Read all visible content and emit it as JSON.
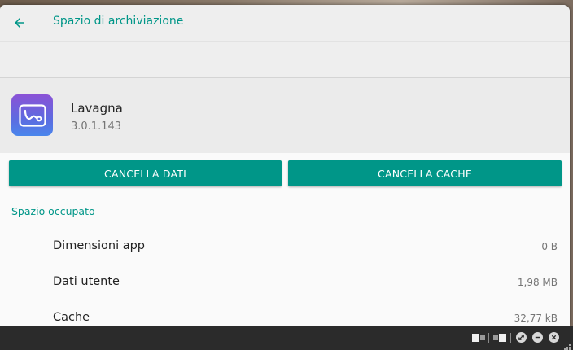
{
  "appbar": {
    "title": "Spazio di archiviazione",
    "back_icon": "arrow-left-icon"
  },
  "app": {
    "name": "Lavagna",
    "version": "3.0.1.143",
    "icon": "whiteboard-app-icon"
  },
  "actions": {
    "clear_data": "CANCELLA DATI",
    "clear_cache": "CANCELLA CACHE"
  },
  "storage": {
    "section_title": "Spazio occupato",
    "rows": [
      {
        "label": "Dimensioni app",
        "value": "0 B"
      },
      {
        "label": "Dati utente",
        "value": "1,98 MB"
      },
      {
        "label": "Cache",
        "value": "32,77 kB"
      }
    ]
  },
  "taskbar": {
    "icons": [
      "window-layout-left-icon",
      "window-layout-right-icon",
      "expand-icon",
      "minimize-icon",
      "close-icon",
      "resize-grip-icon"
    ]
  },
  "colors": {
    "accent": "#009688",
    "appbar_bg": "#eeeeee",
    "content_bg": "#fafafa",
    "taskbar_bg": "#2b2b2b"
  }
}
